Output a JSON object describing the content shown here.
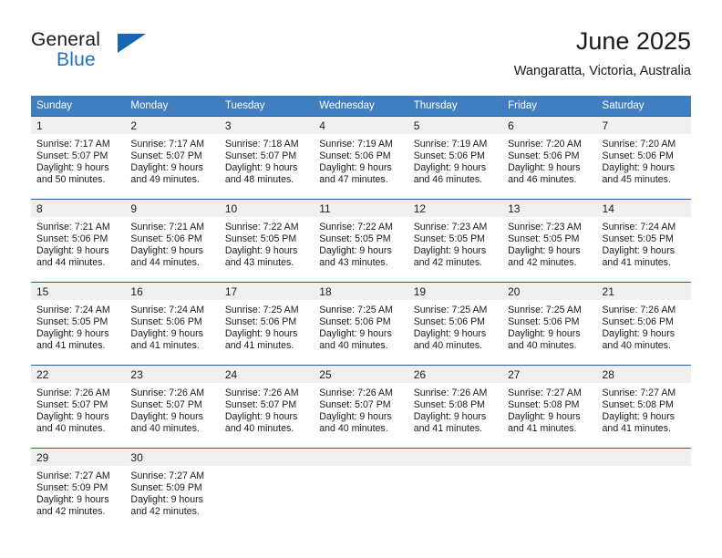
{
  "logo": {
    "word_one": "General",
    "word_two": "Blue",
    "triangle_color": "#1565b0",
    "blue_text_color": "#1f6fc4",
    "icon": "general-blue-logo"
  },
  "header": {
    "title": "June 2025",
    "location": "Wangaratta, Victoria, Australia"
  },
  "colors": {
    "header_blue": "#3f7fc1",
    "row_rule_blue": "#1f5fa6",
    "daynum_gray": "#f0f0f0",
    "text": "#1a1a1a"
  },
  "weekdays": [
    "Sunday",
    "Monday",
    "Tuesday",
    "Wednesday",
    "Thursday",
    "Friday",
    "Saturday"
  ],
  "weeks": [
    [
      {
        "day": "1",
        "sunrise": "Sunrise: 7:17 AM",
        "sunset": "Sunset: 5:07 PM",
        "daylight_line1": "Daylight: 9 hours",
        "daylight_line2": "and 50 minutes."
      },
      {
        "day": "2",
        "sunrise": "Sunrise: 7:17 AM",
        "sunset": "Sunset: 5:07 PM",
        "daylight_line1": "Daylight: 9 hours",
        "daylight_line2": "and 49 minutes."
      },
      {
        "day": "3",
        "sunrise": "Sunrise: 7:18 AM",
        "sunset": "Sunset: 5:07 PM",
        "daylight_line1": "Daylight: 9 hours",
        "daylight_line2": "and 48 minutes."
      },
      {
        "day": "4",
        "sunrise": "Sunrise: 7:19 AM",
        "sunset": "Sunset: 5:06 PM",
        "daylight_line1": "Daylight: 9 hours",
        "daylight_line2": "and 47 minutes."
      },
      {
        "day": "5",
        "sunrise": "Sunrise: 7:19 AM",
        "sunset": "Sunset: 5:06 PM",
        "daylight_line1": "Daylight: 9 hours",
        "daylight_line2": "and 46 minutes."
      },
      {
        "day": "6",
        "sunrise": "Sunrise: 7:20 AM",
        "sunset": "Sunset: 5:06 PM",
        "daylight_line1": "Daylight: 9 hours",
        "daylight_line2": "and 46 minutes."
      },
      {
        "day": "7",
        "sunrise": "Sunrise: 7:20 AM",
        "sunset": "Sunset: 5:06 PM",
        "daylight_line1": "Daylight: 9 hours",
        "daylight_line2": "and 45 minutes."
      }
    ],
    [
      {
        "day": "8",
        "sunrise": "Sunrise: 7:21 AM",
        "sunset": "Sunset: 5:06 PM",
        "daylight_line1": "Daylight: 9 hours",
        "daylight_line2": "and 44 minutes."
      },
      {
        "day": "9",
        "sunrise": "Sunrise: 7:21 AM",
        "sunset": "Sunset: 5:06 PM",
        "daylight_line1": "Daylight: 9 hours",
        "daylight_line2": "and 44 minutes."
      },
      {
        "day": "10",
        "sunrise": "Sunrise: 7:22 AM",
        "sunset": "Sunset: 5:05 PM",
        "daylight_line1": "Daylight: 9 hours",
        "daylight_line2": "and 43 minutes."
      },
      {
        "day": "11",
        "sunrise": "Sunrise: 7:22 AM",
        "sunset": "Sunset: 5:05 PM",
        "daylight_line1": "Daylight: 9 hours",
        "daylight_line2": "and 43 minutes."
      },
      {
        "day": "12",
        "sunrise": "Sunrise: 7:23 AM",
        "sunset": "Sunset: 5:05 PM",
        "daylight_line1": "Daylight: 9 hours",
        "daylight_line2": "and 42 minutes."
      },
      {
        "day": "13",
        "sunrise": "Sunrise: 7:23 AM",
        "sunset": "Sunset: 5:05 PM",
        "daylight_line1": "Daylight: 9 hours",
        "daylight_line2": "and 42 minutes."
      },
      {
        "day": "14",
        "sunrise": "Sunrise: 7:24 AM",
        "sunset": "Sunset: 5:05 PM",
        "daylight_line1": "Daylight: 9 hours",
        "daylight_line2": "and 41 minutes."
      }
    ],
    [
      {
        "day": "15",
        "sunrise": "Sunrise: 7:24 AM",
        "sunset": "Sunset: 5:05 PM",
        "daylight_line1": "Daylight: 9 hours",
        "daylight_line2": "and 41 minutes."
      },
      {
        "day": "16",
        "sunrise": "Sunrise: 7:24 AM",
        "sunset": "Sunset: 5:06 PM",
        "daylight_line1": "Daylight: 9 hours",
        "daylight_line2": "and 41 minutes."
      },
      {
        "day": "17",
        "sunrise": "Sunrise: 7:25 AM",
        "sunset": "Sunset: 5:06 PM",
        "daylight_line1": "Daylight: 9 hours",
        "daylight_line2": "and 41 minutes."
      },
      {
        "day": "18",
        "sunrise": "Sunrise: 7:25 AM",
        "sunset": "Sunset: 5:06 PM",
        "daylight_line1": "Daylight: 9 hours",
        "daylight_line2": "and 40 minutes."
      },
      {
        "day": "19",
        "sunrise": "Sunrise: 7:25 AM",
        "sunset": "Sunset: 5:06 PM",
        "daylight_line1": "Daylight: 9 hours",
        "daylight_line2": "and 40 minutes."
      },
      {
        "day": "20",
        "sunrise": "Sunrise: 7:25 AM",
        "sunset": "Sunset: 5:06 PM",
        "daylight_line1": "Daylight: 9 hours",
        "daylight_line2": "and 40 minutes."
      },
      {
        "day": "21",
        "sunrise": "Sunrise: 7:26 AM",
        "sunset": "Sunset: 5:06 PM",
        "daylight_line1": "Daylight: 9 hours",
        "daylight_line2": "and 40 minutes."
      }
    ],
    [
      {
        "day": "22",
        "sunrise": "Sunrise: 7:26 AM",
        "sunset": "Sunset: 5:07 PM",
        "daylight_line1": "Daylight: 9 hours",
        "daylight_line2": "and 40 minutes."
      },
      {
        "day": "23",
        "sunrise": "Sunrise: 7:26 AM",
        "sunset": "Sunset: 5:07 PM",
        "daylight_line1": "Daylight: 9 hours",
        "daylight_line2": "and 40 minutes."
      },
      {
        "day": "24",
        "sunrise": "Sunrise: 7:26 AM",
        "sunset": "Sunset: 5:07 PM",
        "daylight_line1": "Daylight: 9 hours",
        "daylight_line2": "and 40 minutes."
      },
      {
        "day": "25",
        "sunrise": "Sunrise: 7:26 AM",
        "sunset": "Sunset: 5:07 PM",
        "daylight_line1": "Daylight: 9 hours",
        "daylight_line2": "and 40 minutes."
      },
      {
        "day": "26",
        "sunrise": "Sunrise: 7:26 AM",
        "sunset": "Sunset: 5:08 PM",
        "daylight_line1": "Daylight: 9 hours",
        "daylight_line2": "and 41 minutes."
      },
      {
        "day": "27",
        "sunrise": "Sunrise: 7:27 AM",
        "sunset": "Sunset: 5:08 PM",
        "daylight_line1": "Daylight: 9 hours",
        "daylight_line2": "and 41 minutes."
      },
      {
        "day": "28",
        "sunrise": "Sunrise: 7:27 AM",
        "sunset": "Sunset: 5:08 PM",
        "daylight_line1": "Daylight: 9 hours",
        "daylight_line2": "and 41 minutes."
      }
    ],
    [
      {
        "day": "29",
        "sunrise": "Sunrise: 7:27 AM",
        "sunset": "Sunset: 5:09 PM",
        "daylight_line1": "Daylight: 9 hours",
        "daylight_line2": "and 42 minutes."
      },
      {
        "day": "30",
        "sunrise": "Sunrise: 7:27 AM",
        "sunset": "Sunset: 5:09 PM",
        "daylight_line1": "Daylight: 9 hours",
        "daylight_line2": "and 42 minutes."
      },
      {
        "day": "",
        "sunrise": "",
        "sunset": "",
        "daylight_line1": "",
        "daylight_line2": ""
      },
      {
        "day": "",
        "sunrise": "",
        "sunset": "",
        "daylight_line1": "",
        "daylight_line2": ""
      },
      {
        "day": "",
        "sunrise": "",
        "sunset": "",
        "daylight_line1": "",
        "daylight_line2": ""
      },
      {
        "day": "",
        "sunrise": "",
        "sunset": "",
        "daylight_line1": "",
        "daylight_line2": ""
      },
      {
        "day": "",
        "sunrise": "",
        "sunset": "",
        "daylight_line1": "",
        "daylight_line2": ""
      }
    ]
  ]
}
